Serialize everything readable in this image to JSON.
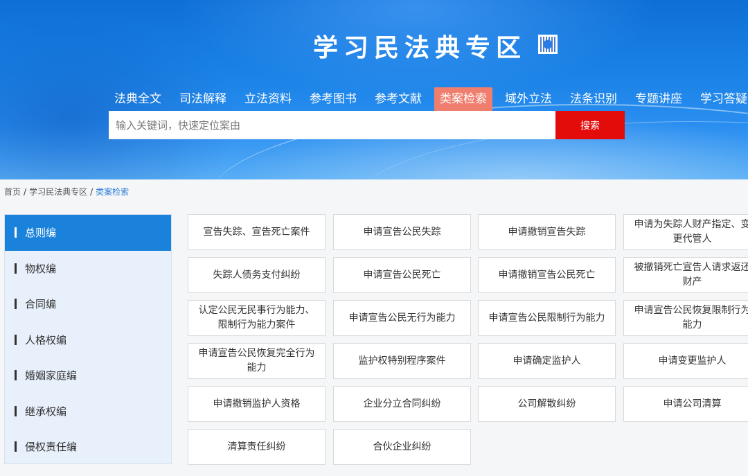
{
  "header": {
    "title": "学习民法典专区",
    "qr_icon": "qr-code-icon"
  },
  "nav": {
    "items": [
      "法典全文",
      "司法解释",
      "立法资料",
      "参考图书",
      "参考文献",
      "类案检索",
      "域外立法",
      "法条识别",
      "专题讲座",
      "学习答疑"
    ],
    "active_index": 5
  },
  "search": {
    "placeholder": "输入关键词，快速定位案由",
    "value": "",
    "button_label": "搜索"
  },
  "breadcrumb": [
    "首页",
    "学习民法典专区",
    "类案检索"
  ],
  "sidebar": {
    "items": [
      "总则编",
      "物权编",
      "合同编",
      "人格权编",
      "婚姻家庭编",
      "继承权编",
      "侵权责任编"
    ],
    "active_index": 0
  },
  "cards": [
    "宣告失踪、宣告死亡案件",
    "申请宣告公民失踪",
    "申请撤销宣告失踪",
    "申请为失踪人财产指定、变更代管人",
    "失踪人债务支付纠纷",
    "申请宣告公民死亡",
    "申请撤销宣告公民死亡",
    "被撤销死亡宣告人请求返还财产",
    "认定公民无民事行为能力、限制行为能力案件",
    "申请宣告公民无行为能力",
    "申请宣告公民限制行为能力",
    "申请宣告公民恢复限制行为能力",
    "申请宣告公民恢复完全行为能力",
    "监护权特别程序案件",
    "申请确定监护人",
    "申请变更监护人",
    "申请撤销监护人资格",
    "企业分立合同纠纷",
    "公司解散纠纷",
    "申请公司清算",
    "清算责任纠纷",
    "合伙企业纠纷"
  ],
  "colors": {
    "active_nav": "#f07e6e",
    "search_button": "#e40b0b",
    "sidebar_active": "#1b82db",
    "breadcrumb_active": "#2b7bd6"
  }
}
